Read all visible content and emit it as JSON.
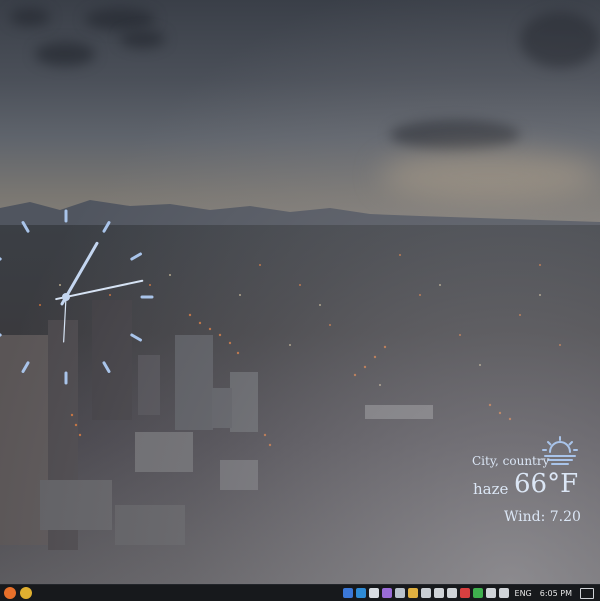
{
  "weather": {
    "location": "City, country",
    "condition": "haze",
    "temperature": "66°F",
    "wind": "Wind: 7.20",
    "icon": "sunrise-haze-icon",
    "text_color": "#d6e3f4"
  },
  "clock": {
    "hour_hand_angle_deg": 30,
    "minute_hand_angle_deg": 78,
    "second_hand_angle_deg": 183,
    "tick_color": "#a9c4ea"
  },
  "taskbar": {
    "apps": [
      {
        "icon": "firefox-icon",
        "color": "#e8702a"
      },
      {
        "icon": "chrome-icon",
        "color": "#e0b030"
      }
    ],
    "tray_icons": [
      {
        "icon": "monitor-icon",
        "color": "#3b78d8"
      },
      {
        "icon": "network-icon",
        "color": "#2e8bd6"
      },
      {
        "icon": "gamepad-icon",
        "color": "#d8dde3"
      },
      {
        "icon": "visual-studio-icon",
        "color": "#9a6cd8"
      },
      {
        "icon": "steam-icon",
        "color": "#b9c2cc"
      },
      {
        "icon": "app-icon",
        "color": "#e0b040"
      },
      {
        "icon": "gear-icon",
        "color": "#c9ced4"
      },
      {
        "icon": "window-icon",
        "color": "#d0d4d8"
      },
      {
        "icon": "volume-icon",
        "color": "#d0d4d8"
      },
      {
        "icon": "security-icon",
        "color": "#d84040"
      },
      {
        "icon": "shield-icon",
        "color": "#3fb04e"
      },
      {
        "icon": "sync-icon",
        "color": "#d0d4d8"
      },
      {
        "icon": "bluetooth-icon",
        "color": "#d0d4d8"
      }
    ],
    "language": "ENG",
    "time": "6:05 PM"
  }
}
